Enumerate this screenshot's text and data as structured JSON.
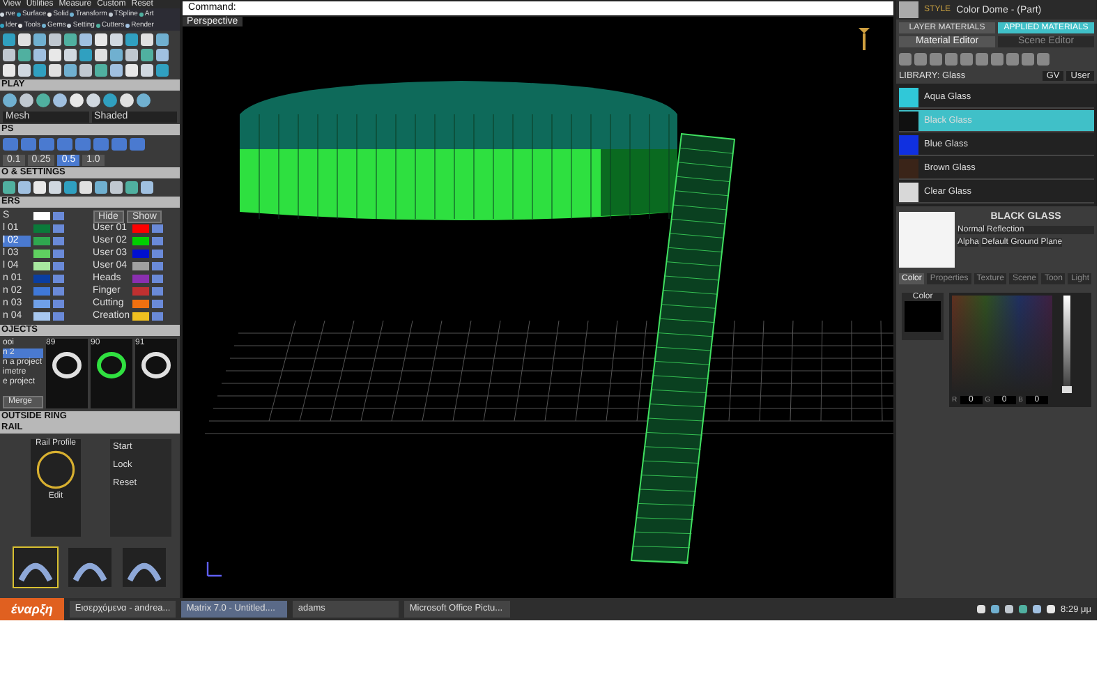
{
  "left_panel": {
    "menu_top": [
      "View",
      "Utilities",
      "Measure",
      "Custom",
      "Reset"
    ],
    "menu_rows": [
      [
        "rve",
        "Surface",
        "Solid",
        "Transform",
        "TSpline",
        "Art"
      ],
      [
        "lder",
        "Tools",
        "Gems",
        "Setting",
        "Cutters",
        "Render"
      ]
    ],
    "display": {
      "title": "PLAY",
      "dropdowns": [
        "Mesh",
        "Shaded"
      ]
    },
    "snaps": {
      "title": "PS",
      "values": [
        {
          "label": "0.1",
          "selected": false
        },
        {
          "label": "0.25",
          "selected": false
        },
        {
          "label": "0.5",
          "selected": true
        },
        {
          "label": "1.0",
          "selected": false
        }
      ]
    },
    "settings": {
      "title": "O & SETTINGS"
    },
    "layers": {
      "title": "ERS",
      "hide": "Hide",
      "show": "Show",
      "left": [
        {
          "name": "S",
          "color": "#ffffff",
          "selected": false
        },
        {
          "name": "l 01",
          "color": "#0a7a3a",
          "selected": false
        },
        {
          "name": "l 02",
          "color": "#2fa84f",
          "selected": true
        },
        {
          "name": "l 03",
          "color": "#5fd060",
          "selected": false
        },
        {
          "name": "l 04",
          "color": "#a8e8a0",
          "selected": false
        },
        {
          "name": "n 01",
          "color": "#0a3ea0",
          "selected": false
        },
        {
          "name": "n 02",
          "color": "#3f78d8",
          "selected": false
        },
        {
          "name": "n 03",
          "color": "#6fa0e8",
          "selected": false
        },
        {
          "name": "n 04",
          "color": "#a8c8f0",
          "selected": false
        }
      ],
      "right": [
        {
          "name": "User 01",
          "color": "#ff0000",
          "selected": false
        },
        {
          "name": "User 02",
          "color": "#00d000",
          "selected": false
        },
        {
          "name": "User 03",
          "color": "#0010d0",
          "selected": false
        },
        {
          "name": "User 04",
          "color": "#a0a0a0",
          "selected": false
        },
        {
          "name": "Heads",
          "color": "#8a2fb0",
          "selected": false
        },
        {
          "name": "Finger",
          "color": "#c03030",
          "selected": false
        },
        {
          "name": "Cutting",
          "color": "#f07010",
          "selected": false
        },
        {
          "name": "Creation",
          "color": "#f0c020",
          "selected": false
        }
      ]
    },
    "projects": {
      "title": "OJECTS",
      "items": [
        {
          "label": "ooi",
          "selected": false
        },
        {
          "label": "n 2",
          "selected": true
        },
        {
          "label": "n a project",
          "selected": false
        },
        {
          "label": "imetre",
          "selected": false
        },
        {
          "label": "e project",
          "selected": false
        }
      ],
      "thumbs": [
        "89",
        "90",
        "91"
      ],
      "merge": "Merge"
    },
    "rail": {
      "title": "OUTSIDE RING",
      "subtitle": "RAIL",
      "profile": "Rail Profile",
      "edit": "Edit",
      "options": [
        "Start",
        "Lock",
        "Reset"
      ]
    }
  },
  "viewport": {
    "command_label": "Command:",
    "view_name": "Perspective"
  },
  "right_panel": {
    "style_label": "STYLE",
    "style_value": "Color Dome - (Part)",
    "tabs": [
      {
        "label": "LAYER MATERIALS",
        "selected": false
      },
      {
        "label": "APPLIED MATERIALS",
        "selected": true
      }
    ],
    "editor_tabs": [
      {
        "label": "Material Editor",
        "selected": true
      },
      {
        "label": "Scene Editor",
        "selected": false
      }
    ],
    "library": "LIBRARY: Glass",
    "library_buttons": [
      "GV",
      "User"
    ],
    "materials": [
      {
        "name": "Aqua Glass",
        "color": "#30c8d8",
        "selected": false
      },
      {
        "name": "Black Glass",
        "color": "#101010",
        "selected": true
      },
      {
        "name": "Blue Glass",
        "color": "#1030e0",
        "selected": false
      },
      {
        "name": "Brown Glass",
        "color": "#3a2418",
        "selected": false
      },
      {
        "name": "Clear Glass",
        "color": "#d8d8d8",
        "selected": false
      }
    ],
    "material_title": "BLACK GLASS",
    "reflection": "Normal Reflection",
    "alpha": "Alpha",
    "ground": "Default Ground Plane",
    "prop_tabs": [
      {
        "label": "Color",
        "selected": true
      },
      {
        "label": "Properties",
        "selected": false
      },
      {
        "label": "Texture",
        "selected": false
      },
      {
        "label": "Scene",
        "selected": false
      },
      {
        "label": "Toon",
        "selected": false
      },
      {
        "label": "Light",
        "selected": false
      }
    ],
    "color_label": "Color",
    "brightness": {
      "level": 0
    },
    "rgb": [
      {
        "label": "R",
        "value": "0"
      },
      {
        "label": "G",
        "value": "0"
      },
      {
        "label": "B",
        "value": "0"
      }
    ]
  },
  "taskbar": {
    "start": "έναρξη",
    "items": [
      {
        "label": "Εισερχόμενα - andrea...",
        "selected": false
      },
      {
        "label": "Matrix 7.0 - Untitled....",
        "selected": true
      },
      {
        "label": "adams",
        "selected": false
      },
      {
        "label": "Microsoft Office Pictu...",
        "selected": false
      }
    ],
    "clock": "8:29 μμ"
  }
}
